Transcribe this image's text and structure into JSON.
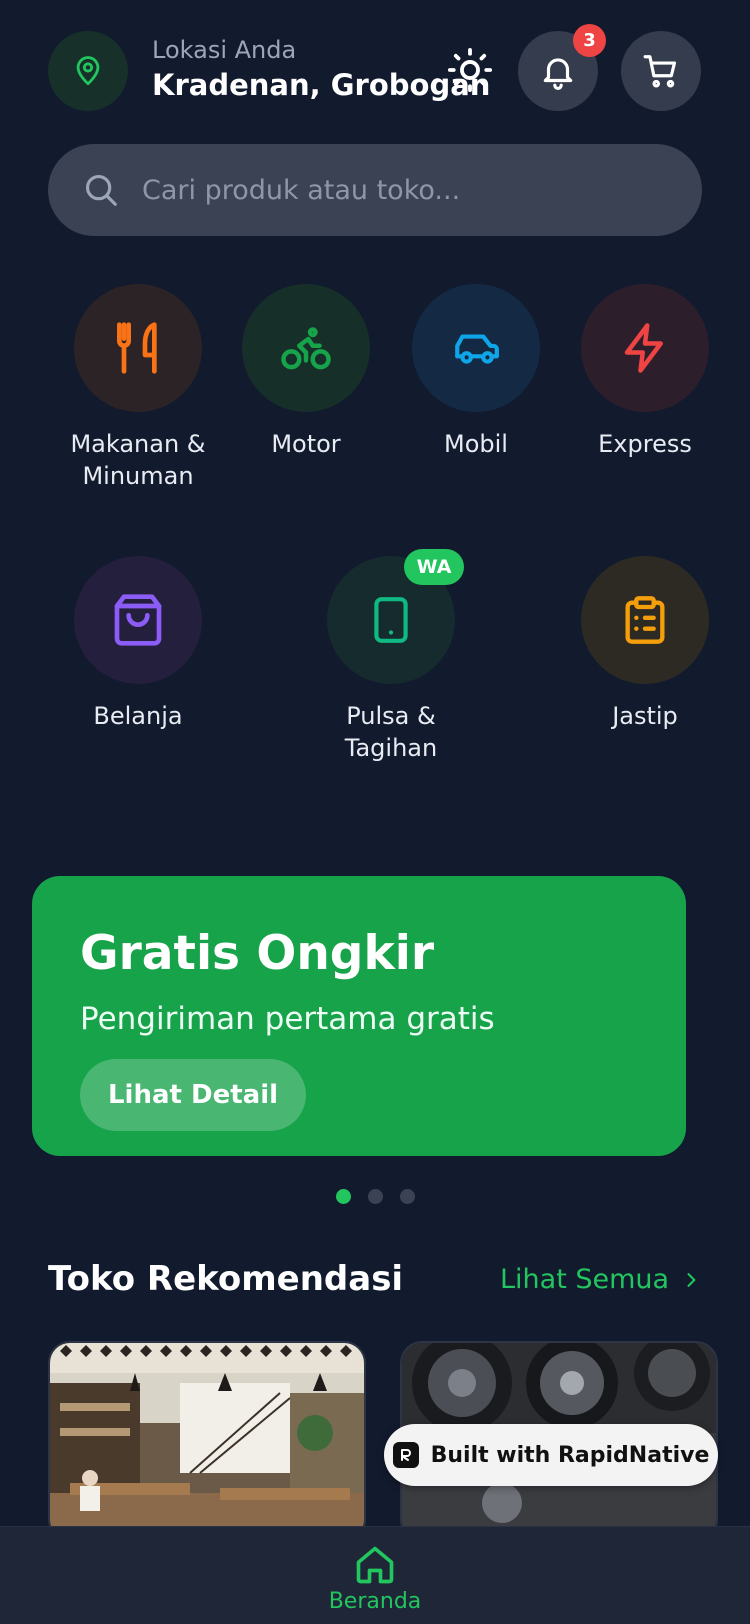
{
  "header": {
    "location_label": "Lokasi Anda",
    "location_value": "Kradenan, Grobogan",
    "notification_count": "3"
  },
  "search": {
    "placeholder": "Cari produk atau toko..."
  },
  "categories": [
    {
      "label": "Makanan & Minuman",
      "icon": "utensils-icon",
      "color": "#f97316"
    },
    {
      "label": "Motor",
      "icon": "bike-icon",
      "color": "#16a34a"
    },
    {
      "label": "Mobil",
      "icon": "car-icon",
      "color": "#0ea5e9"
    },
    {
      "label": "Express",
      "icon": "lightning-icon",
      "color": "#ef4444"
    },
    {
      "label": "Belanja",
      "icon": "shopping-bag-icon",
      "color": "#8b5cf6"
    },
    {
      "label": "Pulsa & Tagihan",
      "icon": "smartphone-icon",
      "color": "#10b981",
      "badge": "WA"
    },
    {
      "label": "Jastip",
      "icon": "clipboard-icon",
      "color": "#f59e0b"
    }
  ],
  "promo": {
    "title": "Gratis Ongkir",
    "subtitle": "Pengiriman pertama gratis",
    "button_label": "Lihat Detail",
    "active_slide": 1,
    "slide_count": 3
  },
  "recommendations": {
    "title": "Toko Rekomendasi",
    "see_all_label": "Lihat Semua"
  },
  "watermark": {
    "label": "Built with RapidNative"
  },
  "bottom_nav": {
    "home_label": "Beranda"
  },
  "colors": {
    "background": "#121a2e",
    "accent": "#22c55e",
    "promo": "#16a34a",
    "badge": "#ef4444"
  }
}
